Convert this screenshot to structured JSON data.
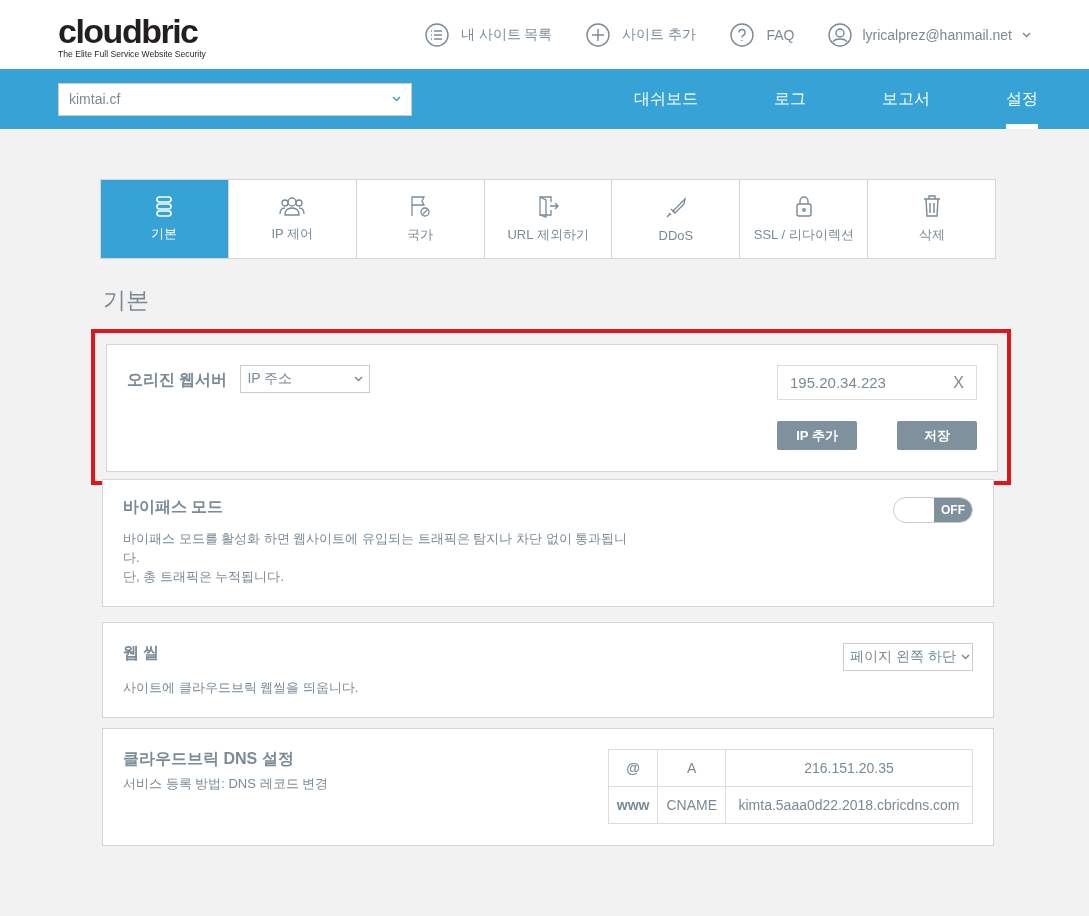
{
  "header": {
    "logo": "cloudbric",
    "tagline": "The Elite Full Service Website Security",
    "links": [
      {
        "kind": "list",
        "label": "내 사이트 목록"
      },
      {
        "kind": "add",
        "label": "사이트 추가"
      },
      {
        "kind": "help",
        "label": "FAQ"
      }
    ],
    "account": "lyricalprez@hanmail.net"
  },
  "navbar": {
    "site": "kimtai.cf",
    "items": [
      {
        "label": "대쉬보드",
        "selected": false
      },
      {
        "label": "로그",
        "selected": false
      },
      {
        "label": "보고서",
        "selected": false
      },
      {
        "label": "설정",
        "selected": true
      }
    ]
  },
  "tabs": [
    {
      "kind": "server",
      "label": "기본",
      "selected": true
    },
    {
      "kind": "users",
      "label": "IP 제어",
      "selected": false
    },
    {
      "kind": "flag",
      "label": "국가",
      "selected": false
    },
    {
      "kind": "exit",
      "label": "URL 제외하기",
      "selected": false
    },
    {
      "kind": "sword",
      "label": "DDoS",
      "selected": false
    },
    {
      "kind": "lock",
      "label": "SSL / 리다이렉션",
      "selected": false
    },
    {
      "kind": "trash",
      "label": "삭제",
      "selected": false
    }
  ],
  "section_title": "기본",
  "origin": {
    "highlighted": true,
    "label": "오리진 웹서버",
    "type_select": "IP 주소",
    "ip_value": "195.20.34.223",
    "clear": "X",
    "buttons": [
      "IP 추가",
      "저장"
    ]
  },
  "bypass": {
    "title": "바이패스 모드",
    "on": false,
    "toggle_label": "OFF",
    "lines": [
      "바이패스 모드를 활성화 하면 웹사이트에 유입되는 트래픽은 탐지나 차단 없이 통과됩니다.",
      "단, 총 트래픽은 누적됩니다."
    ]
  },
  "seal": {
    "title": "웹 씰",
    "description": "사이트에 클라우드브릭 웹씰을 띄웁니다.",
    "position_select": "페이지 왼쪽 하단"
  },
  "dns": {
    "title": "클라우드브릭 DNS 설정",
    "description": "서비스 등록 방법: DNS 레코드 변경",
    "rows": [
      [
        "@",
        "A",
        "216.151.20.35"
      ],
      [
        "www",
        "CNAME",
        "kimta.5aaa0d22.2018.cbricdns.com"
      ]
    ]
  }
}
